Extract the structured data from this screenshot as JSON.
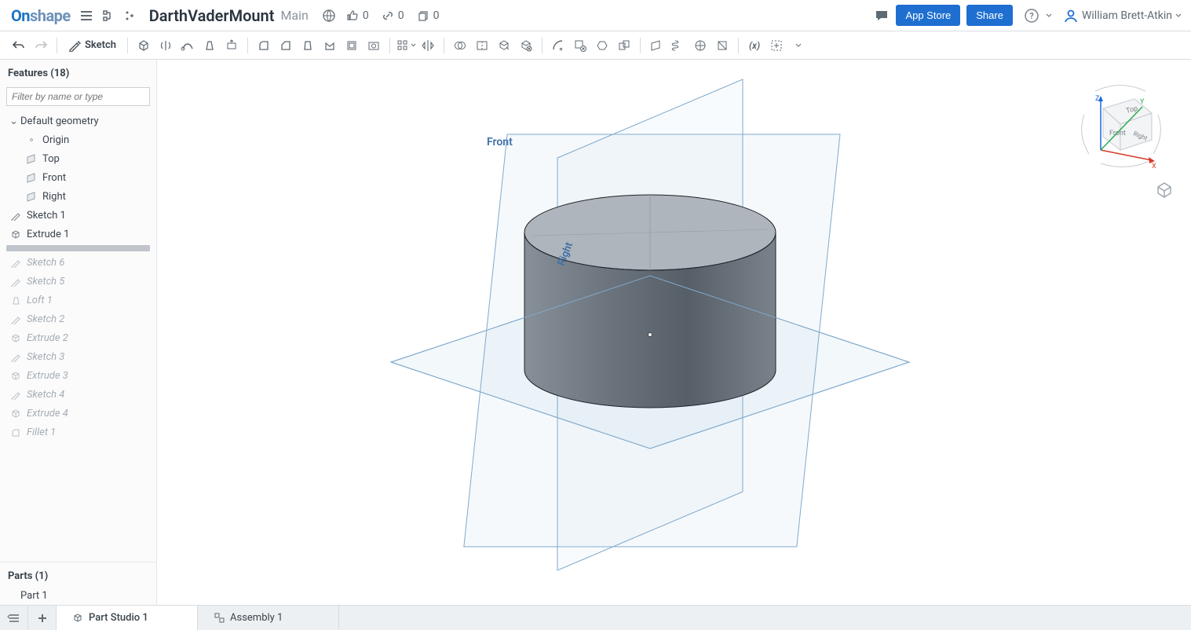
{
  "header": {
    "logo_on": "On",
    "logo_shape": "shape",
    "doc_title": "DarthVaderMount",
    "doc_branch": "Main",
    "likes": "0",
    "links": "0",
    "copies": "0",
    "app_store": "App Store",
    "share": "Share",
    "user_name": "William Brett-Atkin"
  },
  "toolbar": {
    "sketch": "Sketch"
  },
  "sidebar": {
    "features_title": "Features (18)",
    "filter_placeholder": "Filter by name or type",
    "default_geometry": "Default geometry",
    "geom": {
      "origin": "Origin",
      "top": "Top",
      "front": "Front",
      "right": "Right"
    },
    "items": [
      {
        "label": "Sketch 1",
        "icon": "sketch",
        "suppressed": false
      },
      {
        "label": "Extrude 1",
        "icon": "extrude",
        "suppressed": false
      }
    ],
    "suppressed_items": [
      {
        "label": "Sketch 6",
        "icon": "sketch"
      },
      {
        "label": "Sketch 5",
        "icon": "sketch"
      },
      {
        "label": "Loft 1",
        "icon": "loft"
      },
      {
        "label": "Sketch 2",
        "icon": "sketch"
      },
      {
        "label": "Extrude 2",
        "icon": "extrude"
      },
      {
        "label": "Sketch 3",
        "icon": "sketch"
      },
      {
        "label": "Extrude 3",
        "icon": "extrude"
      },
      {
        "label": "Sketch 4",
        "icon": "sketch"
      },
      {
        "label": "Extrude 4",
        "icon": "extrude"
      },
      {
        "label": "Fillet 1",
        "icon": "fillet"
      }
    ],
    "parts_title": "Parts (1)",
    "parts": [
      "Part 1"
    ]
  },
  "canvas": {
    "front_label": "Front",
    "right_label": "Right"
  },
  "viewcube": {
    "top": "Top",
    "front": "Front",
    "right": "Right",
    "x": "X",
    "y": "Y",
    "z": "Z"
  },
  "tabs": {
    "part_studio": "Part Studio 1",
    "assembly": "Assembly 1"
  }
}
